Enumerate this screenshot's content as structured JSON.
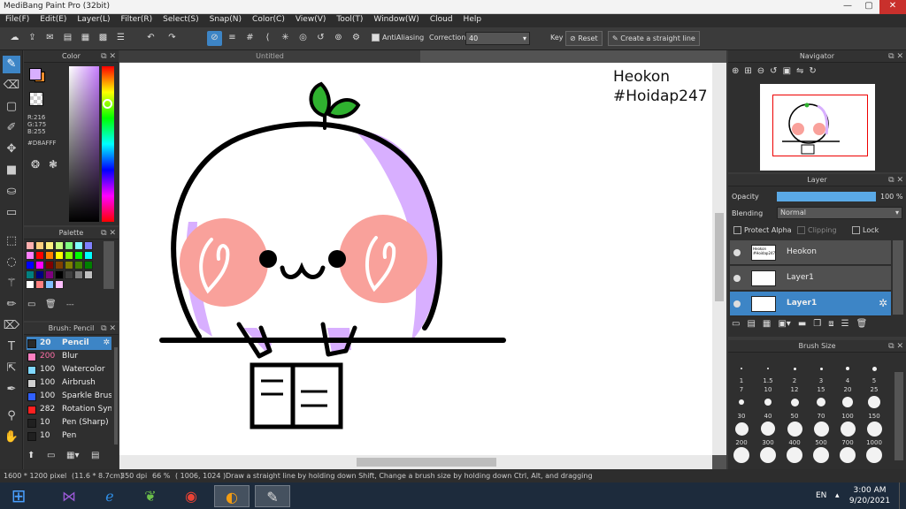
{
  "app": {
    "title": "MediBang Paint Pro (32bit)"
  },
  "window_controls": {
    "minimize": "—",
    "maximize": "▢",
    "close": "✕"
  },
  "menu": [
    "File(F)",
    "Edit(E)",
    "Layer(L)",
    "Filter(R)",
    "Select(S)",
    "Snap(N)",
    "Color(C)",
    "View(V)",
    "Tool(T)",
    "Window(W)",
    "Cloud",
    "Help"
  ],
  "toolbar": {
    "antialiasing_label": "AntiAliasing",
    "correction_label": "Correction",
    "correction_value": "40",
    "key_label": "Key",
    "reset_label": "Reset",
    "straight_line_label": "Create a straight line"
  },
  "color_panel": {
    "title": "Color",
    "r": "R:216",
    "g": "G:175",
    "b": "B:255",
    "hex": "#D8AFFF",
    "main_color": "#D8AFFF",
    "sub_color": "#F08C2C"
  },
  "palette": {
    "title": "Palette",
    "colors": [
      "#ffb0b0",
      "#ffd080",
      "#fff080",
      "#c8ff80",
      "#80ff80",
      "#80ffff",
      "#8080ff",
      "#ff80ff",
      "#ff0000",
      "#ff8000",
      "#ffff00",
      "#80ff00",
      "#00ff00",
      "#00ffff",
      "#0000ff",
      "#ff00ff",
      "#800000",
      "#804000",
      "#808000",
      "#408000",
      "#008000",
      "#008080",
      "#000080",
      "#800080",
      "#000000",
      "#404040",
      "#808080",
      "#c0c0c0",
      "#ffffff",
      "#ff8080",
      "#80c0ff",
      "#ffc0ff"
    ],
    "footer_text": "---"
  },
  "brush_panel": {
    "title": "Brush: Pencil",
    "items": [
      {
        "size": "20",
        "name": "Pencil",
        "color": "#2a2a2a"
      },
      {
        "size": "200",
        "name": "Blur",
        "color": "#ff80c0"
      },
      {
        "size": "100",
        "name": "Watercolor",
        "color": "#80d8ff"
      },
      {
        "size": "100",
        "name": "Airbrush",
        "color": "#d0d0d0"
      },
      {
        "size": "100",
        "name": "Sparkle Brush",
        "color": "#3060ff"
      },
      {
        "size": "282",
        "name": "Rotation Symmetry",
        "color": "#ff2020"
      },
      {
        "size": "10",
        "name": "Pen (Sharp)",
        "color": "#202020"
      },
      {
        "size": "10",
        "name": "Pen",
        "color": "#202020"
      }
    ]
  },
  "document": {
    "tab_title": "Untitled",
    "canvas_text_1": "Heokon",
    "canvas_text_2": "#Hoidap247",
    "blush_color": "#F9A19B",
    "shadow_color": "#D8AFFF",
    "sprout_color": "#2FB12F"
  },
  "navigator": {
    "title": "Navigator"
  },
  "layer_panel": {
    "title": "Layer",
    "opacity_label": "Opacity",
    "opacity_value": "100 %",
    "opacity_fraction": 1.0,
    "blending_label": "Blending",
    "blending_value": "Normal",
    "protect_alpha": "Protect Alpha",
    "clipping": "Clipping",
    "lock": "Lock",
    "layers": [
      {
        "name": "Heokon",
        "thumb_text": "Heokon #Hoidap247"
      },
      {
        "name": "Layer1",
        "thumb_text": ""
      },
      {
        "name": "Layer1",
        "thumb_text": ""
      }
    ]
  },
  "brush_size": {
    "title": "Brush Size",
    "sizes": [
      "1",
      "1.5",
      "2",
      "3",
      "4",
      "5",
      "7",
      "10",
      "12",
      "15",
      "20",
      "25",
      "30",
      "40",
      "50",
      "70",
      "100",
      "150",
      "200",
      "300",
      "400",
      "500",
      "700",
      "1000"
    ]
  },
  "status": {
    "dims": "1600 * 1200 pixel",
    "cm": "(11.6 * 8.7cm)",
    "dpi": "350 dpi",
    "zoom": "66 %",
    "coords": "( 1006, 1024 )",
    "hint": "Draw a straight line by holding down Shift, Change a brush size by holding down Ctrl, Alt, and dragging"
  },
  "taskbar": {
    "lang": "EN",
    "time": "3:00 AM",
    "date": "9/20/2021"
  }
}
